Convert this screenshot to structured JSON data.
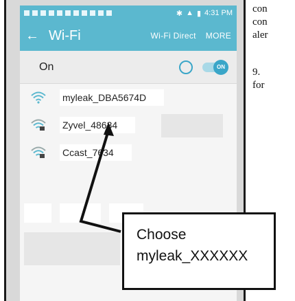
{
  "doc": {
    "line1": "con",
    "line2": "con",
    "line3": "aler",
    "line4": "9.",
    "line5": "for"
  },
  "status_bar": {
    "time": "4:31 PM"
  },
  "app_bar": {
    "title": "Wi-Fi",
    "wifi_direct": "Wi-Fi Direct",
    "more": "MORE"
  },
  "toggle_row": {
    "label": "On",
    "switch_text": "ON"
  },
  "networks": [
    {
      "name": "myleak_DBA5674D",
      "locked": false
    },
    {
      "name": "Zyvel_48634",
      "locked": true
    },
    {
      "name": "Ccast_7634",
      "locked": true
    }
  ],
  "callout": {
    "line1": "Choose",
    "line2": "myleak_XXXXXX"
  },
  "colors": {
    "accent": "#5bb8cf",
    "toggle": "#3aa6c8"
  }
}
